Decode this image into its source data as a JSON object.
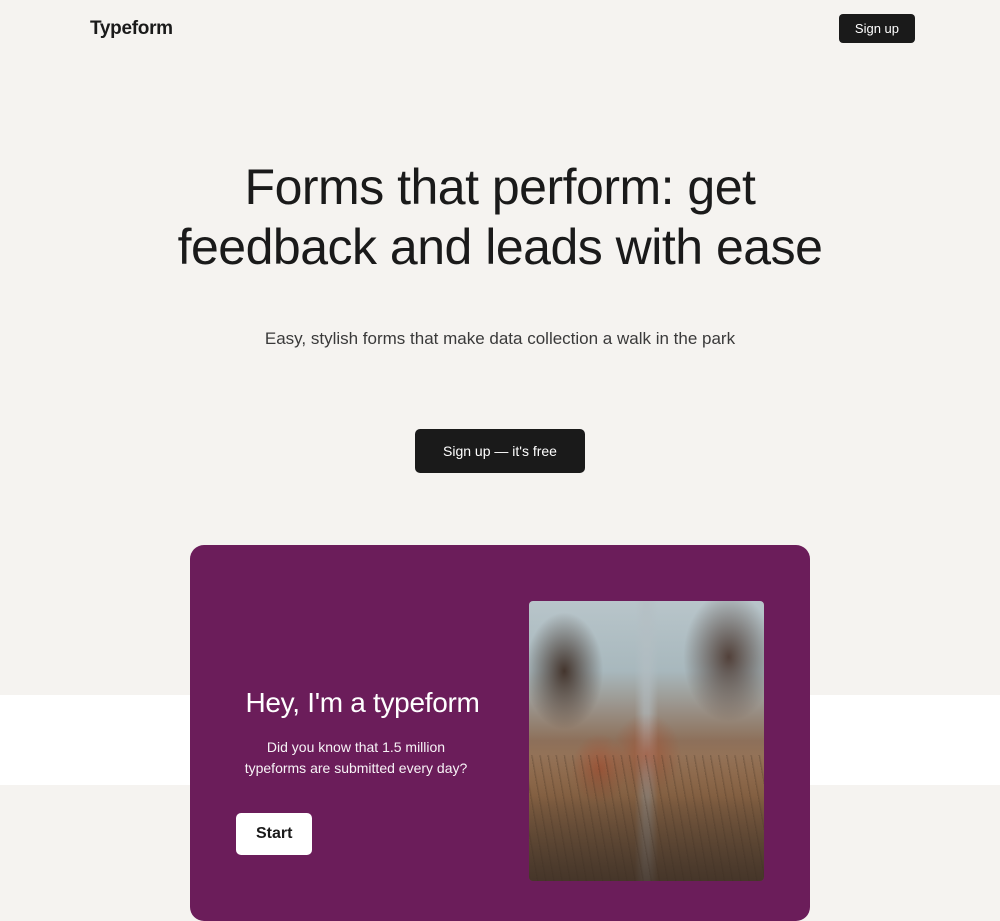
{
  "header": {
    "logo": "Typeform",
    "signup_label": "Sign up"
  },
  "hero": {
    "title": "Forms that perform: get feedback and leads with ease",
    "subtitle": "Easy, stylish forms that make data collection a walk in the park",
    "cta_label": "Sign up — it's free"
  },
  "demo": {
    "title": "Hey, I'm a typeform",
    "text": "Did you know that 1.5 million typeforms are submitted every day?",
    "start_label": "Start"
  }
}
